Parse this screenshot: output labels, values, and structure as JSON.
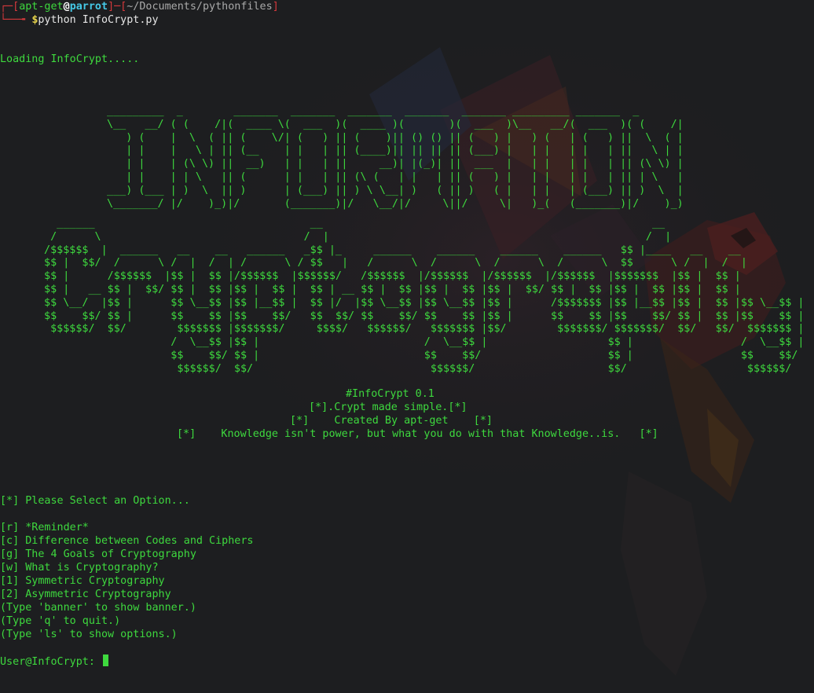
{
  "prompt": {
    "user": "apt-get",
    "at": "@",
    "host": "parrot",
    "path": "~/Documents/pythonfiles",
    "dollar": "$",
    "command": "python InfoCrypt.py"
  },
  "loading": "Loading InfoCrypt.....",
  "art_info": " _________  _        _______  _______  _______  _______  _______ _________ _______  _       \n \\__   __/ ( (    /|(  ____ \\(  ___  )(  ____ )(       )(  ___  )\\__   __/(  ___  )( (    /|\n    ) (    |  \\  ( || (    \\/| (   ) || (    )|| () () || (   ) |   ) (   | (   ) ||  \\  ( |\n    | |    |   \\ | || (__    | |   | || (____)|| || || || (___) |   | |   | |   | ||   \\ | |\n    | |    | (\\ \\) ||  __)   | |   | ||     __)| |(_)| ||  ___  |   | |   | |   | || (\\ \\) |\n    | |    | | \\   || (      | |   | || (\\ (   | |   | || (   ) |   | |   | |   | || | \\   |\n ___) (___ | )  \\  || )      | (___) || ) \\ \\__| )   ( || )   ( |   | |   | (___) || )  \\  |\n \\_______/ |/    )_)|/       (_______)|/   \\__/|/     \\||/     \\|   )_(   (_______)|/    )_)",
  "art_crypto": "   ______                                  __                                                    __                 \n  /      \\                                /  |                                                  /  |                \n /$$$$$$  |  ______   __    __   ______   _$$ |_     ______    ______    ______    ______   $$ |____   __    __ \n $$ |  $$/  /      \\ /  |  /  | /      \\ / $$   |   /      \\  /      \\  /      \\  /      \\  $$      \\ /  |  /  |\n $$ |      /$$$$$$  |$$ |  $$ |/$$$$$$  |$$$$$$/   /$$$$$$  |/$$$$$$  |/$$$$$$  |/$$$$$$  |$$$$$$$  |$$ |  $$ |\n $$ |   __ $$ |  $$/ $$ |  $$ |$$ |  $$ |  $$ | __ $$ |  $$ |$$ |  $$ |$$ |  $$/ $$ |  $$ |$$ |  $$ |$$ |  $$ |\n $$ \\__/  |$$ |      $$ \\__$$ |$$ |__$$ |  $$ |/  |$$ \\__$$ |$$ \\__$$ |$$ |      /$$$$$$$ |$$ |__$$ |$$ |  $$ |$$ \\__$$ |\n $$    $$/ $$ |      $$    $$ |$$    $$/   $$  $$/ $$    $$/ $$    $$ |$$ |      $$    $$ |$$    $$/ $$ |  $$ |$$    $$ |\n  $$$$$$/  $$/        $$$$$$$ |$$$$$$$/     $$$$/   $$$$$$/   $$$$$$$ |$$/        $$$$$$$/ $$$$$$$/  $$/   $$/  $$$$$$$ |\n                     /  \\__$$ |$$ |                          /  \\__$$ |                   $$ |                 /  \\__$$ |\n                     $$    $$/ $$ |                          $$    $$/                    $$ |                 $$    $$/ \n                      $$$$$$/  $$/                            $$$$$$/                     $$/                   $$$$$$/  ",
  "banner_lines": [
    "#InfoCrypt 0.1",
    "[*].Crypt made simple.[*]",
    "[*]    Created By apt-get    [*]",
    "[*]    Knowledge isn't power, but what you do with that Knowledge..is.   [*]"
  ],
  "select_prompt": "[*] Please Select an Option...",
  "menu": [
    "[r] *Reminder*",
    "[c] Difference between Codes and Ciphers",
    "[g] The 4 Goals of Cryptography",
    "[w] What is Cryptography?",
    "[1] Symmetric Cryptography",
    "[2] Asymmetric Cryptography",
    "(Type 'banner' to show banner.)",
    "(Type 'q' to quit.)",
    "(Type 'ls' to show options.)"
  ],
  "input_prompt": "User@InfoCrypt: ",
  "input_value": "",
  "colors": {
    "background": "#1d1e20",
    "text": "#3ed93e",
    "prompt_red": "#d7393c",
    "host_cyan": "#45c8e6",
    "dollar_yellow": "#e7d44b"
  },
  "icons": {
    "background_art": "parrot-logo-icon"
  }
}
